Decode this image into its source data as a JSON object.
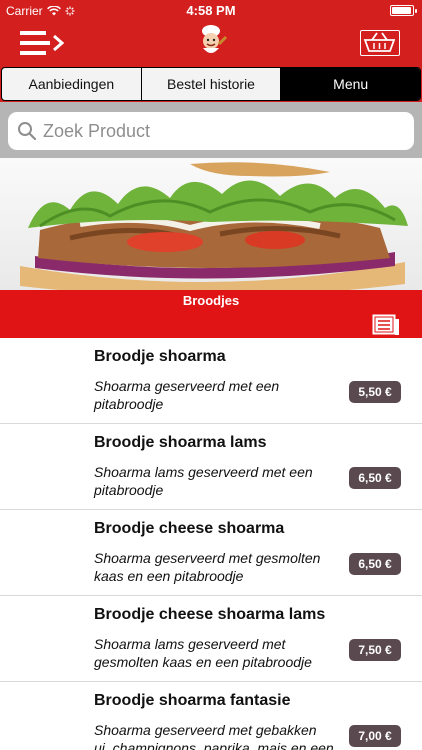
{
  "status_bar": {
    "carrier": "Carrier",
    "time": "4:58 PM",
    "battery_level": 0.95
  },
  "nav": {
    "menu_icon": "menu-arrow-icon",
    "logo_icon": "chef-logo-icon",
    "cart_icon": "basket-icon"
  },
  "tabs": [
    {
      "label": "Aanbiedingen",
      "active": false
    },
    {
      "label": "Bestel historie",
      "active": false
    },
    {
      "label": "Menu",
      "active": true
    }
  ],
  "search": {
    "placeholder": "Zoek Product",
    "icon": "search-icon"
  },
  "category": {
    "title": "Broodjes",
    "icon": "list-icon"
  },
  "products": [
    {
      "name": "Broodje shoarma",
      "description": "Shoarma geserveerd met een pitabroodje",
      "price": "5,50 €"
    },
    {
      "name": "Broodje shoarma lams",
      "description": "Shoarma lams geserveerd met een pitabroodje",
      "price": "6,50 €"
    },
    {
      "name": "Broodje cheese shoarma",
      "description": "Shoarma geserveerd met gesmolten kaas en een pitabroodje",
      "price": "6,50 €"
    },
    {
      "name": "Broodje cheese shoarma lams",
      "description": "Shoarma lams geserveerd met gesmolten kaas en een pitabroodje",
      "price": "7,50 €"
    },
    {
      "name": "Broodje shoarma fantasie",
      "description": "Shoarma geserveerd met gebakken ui, champignons, paprika, mais en een",
      "price": "7,00 €"
    }
  ],
  "colors": {
    "brand_red": "#d41f1f",
    "price_badge": "#5a4a4f",
    "search_bg": "#b6b5b5"
  }
}
